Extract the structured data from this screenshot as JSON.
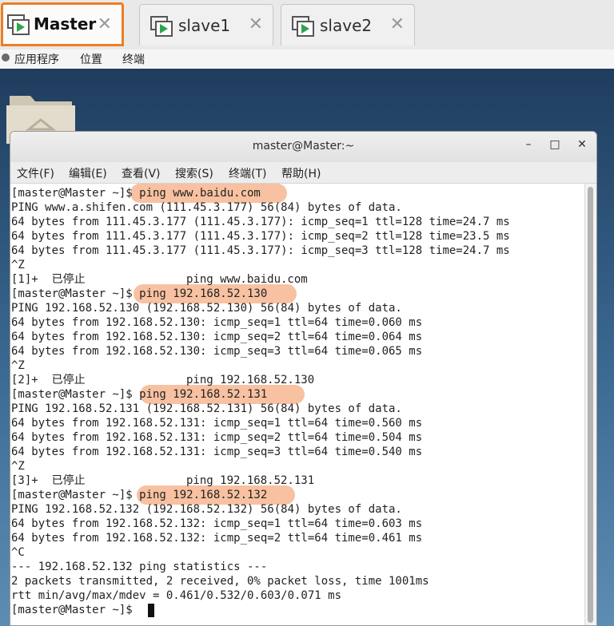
{
  "tabs": [
    {
      "label": "Master",
      "active": true
    },
    {
      "label": "slave1",
      "active": false
    },
    {
      "label": "slave2",
      "active": false
    }
  ],
  "gnome_menu": {
    "apps": "应用程序",
    "places": "位置",
    "terminal": "终端"
  },
  "colors": {
    "active_tab_border": "#ef7d22",
    "highlight": "#f4a06e",
    "vm_icon_play": "#2da44e"
  },
  "window": {
    "title": "master@Master:~",
    "buttons": {
      "minimize": "–",
      "maximize": "□",
      "close": "✕"
    }
  },
  "menu": [
    "文件(F)",
    "编辑(E)",
    "查看(V)",
    "搜索(S)",
    "终端(T)",
    "帮助(H)"
  ],
  "terminal_lines": [
    "[master@Master ~]$ ping www.baidu.com",
    "PING www.a.shifen.com (111.45.3.177) 56(84) bytes of data.",
    "64 bytes from 111.45.3.177 (111.45.3.177): icmp_seq=1 ttl=128 time=24.7 ms",
    "64 bytes from 111.45.3.177 (111.45.3.177): icmp_seq=2 ttl=128 time=23.5 ms",
    "64 bytes from 111.45.3.177 (111.45.3.177): icmp_seq=3 ttl=128 time=24.7 ms",
    "^Z",
    "[1]+  已停止               ping www.baidu.com",
    "[master@Master ~]$ ping 192.168.52.130",
    "PING 192.168.52.130 (192.168.52.130) 56(84) bytes of data.",
    "64 bytes from 192.168.52.130: icmp_seq=1 ttl=64 time=0.060 ms",
    "64 bytes from 192.168.52.130: icmp_seq=2 ttl=64 time=0.064 ms",
    "64 bytes from 192.168.52.130: icmp_seq=3 ttl=64 time=0.065 ms",
    "^Z",
    "[2]+  已停止               ping 192.168.52.130",
    "[master@Master ~]$ ping 192.168.52.131",
    "PING 192.168.52.131 (192.168.52.131) 56(84) bytes of data.",
    "64 bytes from 192.168.52.131: icmp_seq=1 ttl=64 time=0.560 ms",
    "64 bytes from 192.168.52.131: icmp_seq=2 ttl=64 time=0.504 ms",
    "64 bytes from 192.168.52.131: icmp_seq=3 ttl=64 time=0.540 ms",
    "^Z",
    "[3]+  已停止               ping 192.168.52.131",
    "[master@Master ~]$ ping 192.168.52.132",
    "PING 192.168.52.132 (192.168.52.132) 56(84) bytes of data.",
    "64 bytes from 192.168.52.132: icmp_seq=1 ttl=64 time=0.603 ms",
    "64 bytes from 192.168.52.132: icmp_seq=2 ttl=64 time=0.461 ms",
    "^C",
    "--- 192.168.52.132 ping statistics ---",
    "2 packets transmitted, 2 received, 0% packet loss, time 1001ms",
    "rtt min/avg/max/mdev = 0.461/0.532/0.603/0.071 ms",
    "[master@Master ~]$ "
  ]
}
